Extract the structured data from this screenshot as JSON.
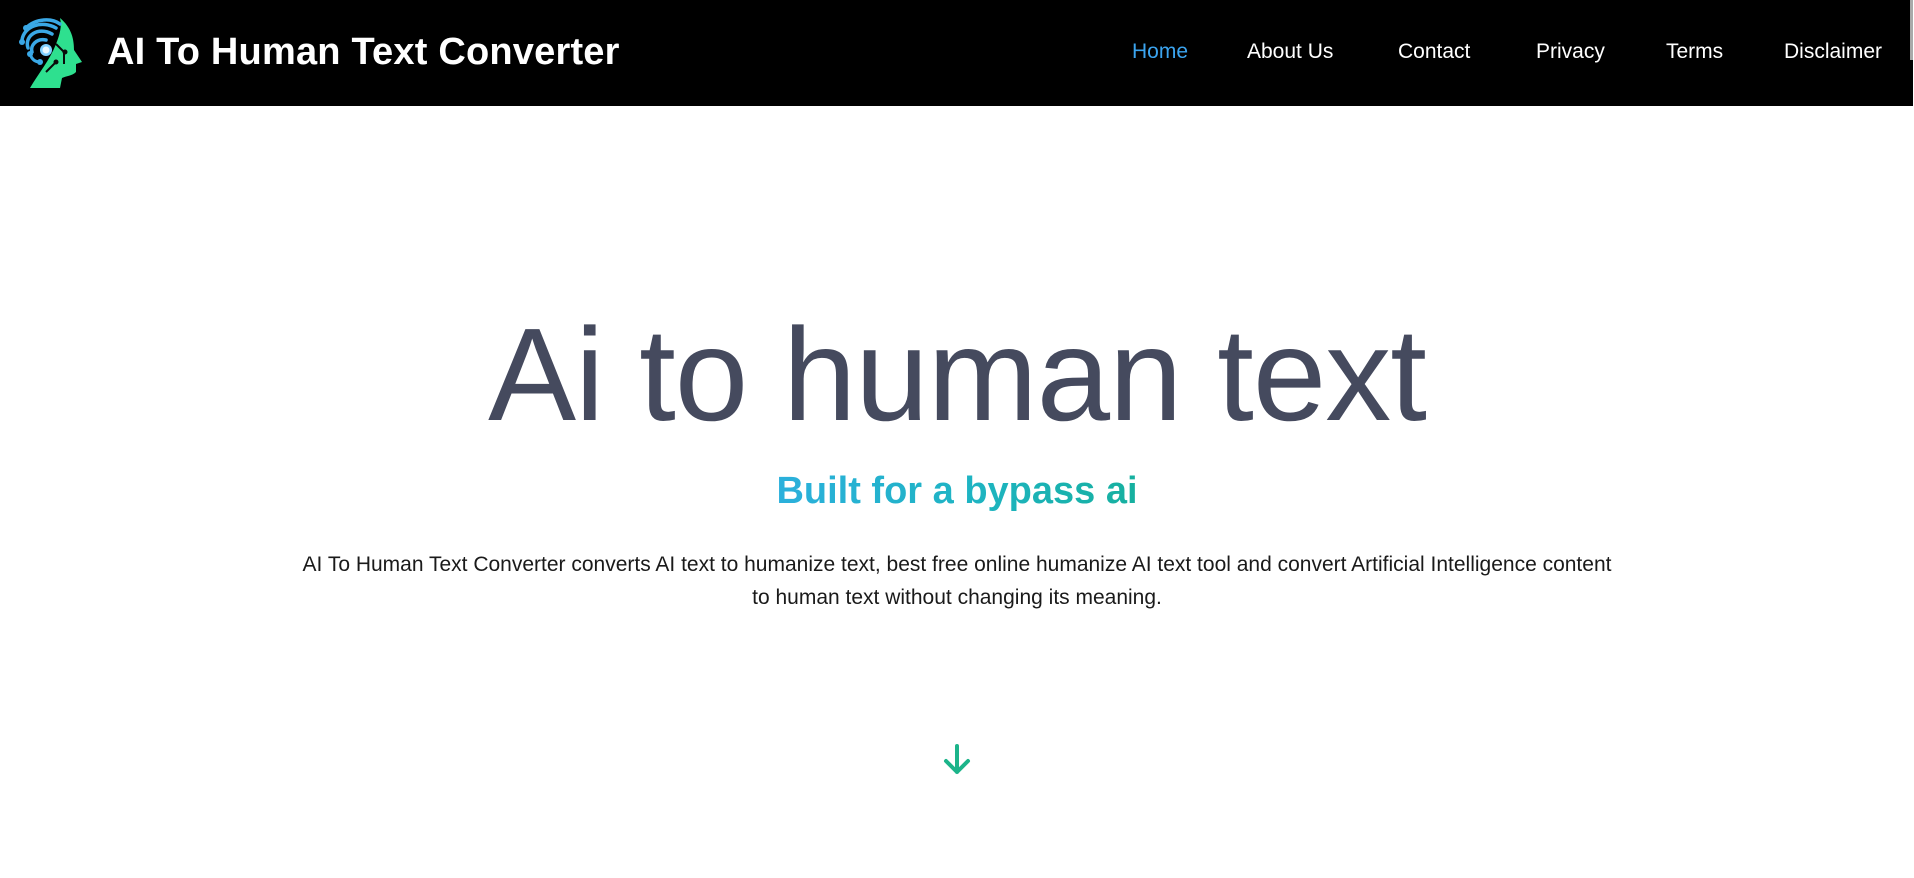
{
  "header": {
    "brand_title": "AI To Human Text Converter",
    "logo_icon": "ai-head-circuit-logo",
    "nav": [
      {
        "label": "Home",
        "active": true
      },
      {
        "label": "About Us",
        "active": false
      },
      {
        "label": "Contact",
        "active": false
      },
      {
        "label": "Privacy",
        "active": false
      },
      {
        "label": "Terms",
        "active": false
      },
      {
        "label": "Disclaimer",
        "active": false
      }
    ]
  },
  "hero": {
    "title": "Ai to human text",
    "subtitle": "Built for a bypass ai",
    "description": "AI To Human Text Converter converts AI text to humanize text, best free online humanize AI text tool and convert Artificial Intelligence content to human text without changing its meaning.",
    "scroll_icon": "arrow-down-icon"
  },
  "colors": {
    "header_bg": "#000000",
    "nav_active": "#3ba4ef",
    "title": "#454a5e",
    "subtitle_gradient_start": "#2bb0dc",
    "subtitle_gradient_end": "#16b09f",
    "arrow": "#1cb48a",
    "logo_blue": "#3aa8e6",
    "logo_green": "#2ee08f"
  }
}
